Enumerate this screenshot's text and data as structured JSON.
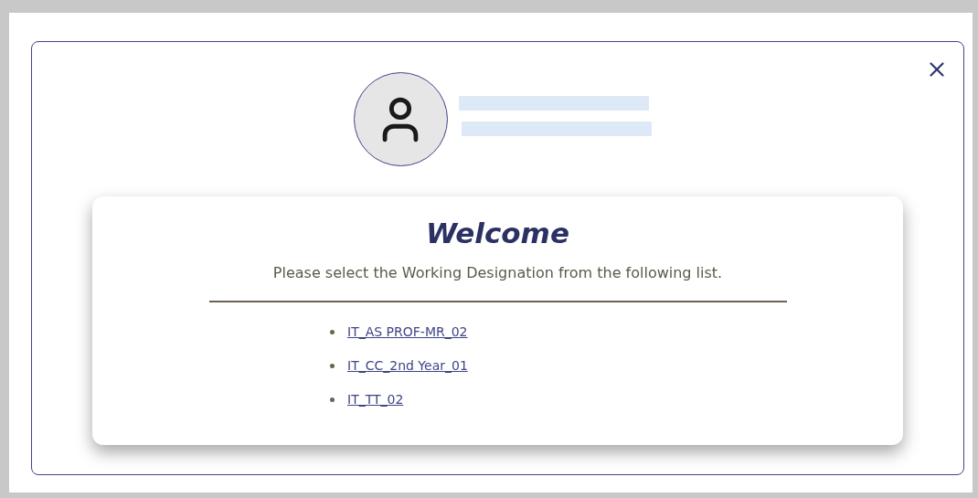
{
  "dialog": {
    "title": "Welcome",
    "message": "Please select the Working Designation from the following list.",
    "designations": [
      {
        "label": "IT_AS PROF-MR_02"
      },
      {
        "label": "IT_CC_2nd Year_01"
      },
      {
        "label": "IT_TT_02"
      }
    ]
  }
}
